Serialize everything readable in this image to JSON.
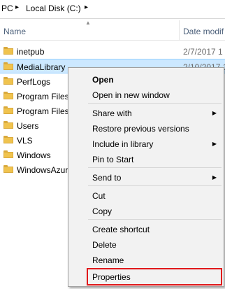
{
  "addressbar": {
    "crumbs": [
      "PC",
      "Local Disk (C:)"
    ],
    "arrow": "▸"
  },
  "columns": {
    "name": "Name",
    "date": "Date modif"
  },
  "files": [
    {
      "name": "inetpub",
      "date": "2/7/2017 1"
    },
    {
      "name": "MediaLibrary",
      "date": "2/10/2017 1"
    },
    {
      "name": "PerfLogs",
      "date": ""
    },
    {
      "name": "Program Files",
      "date": ""
    },
    {
      "name": "Program Files",
      "date": ""
    },
    {
      "name": "Users",
      "date": ""
    },
    {
      "name": "VLS",
      "date": ""
    },
    {
      "name": "Windows",
      "date": ""
    },
    {
      "name": "WindowsAzur",
      "date": ""
    }
  ],
  "context_menu": {
    "items": [
      {
        "label": "Open",
        "bold": true
      },
      {
        "label": "Open in new window"
      },
      {
        "label": "Share with",
        "submenu": true
      },
      {
        "label": "Restore previous versions"
      },
      {
        "label": "Include in library",
        "submenu": true
      },
      {
        "label": "Pin to Start"
      },
      {
        "label": "Send to",
        "submenu": true
      },
      {
        "label": "Cut"
      },
      {
        "label": "Copy"
      },
      {
        "label": "Create shortcut"
      },
      {
        "label": "Delete"
      },
      {
        "label": "Rename"
      },
      {
        "label": "Properties",
        "highlighted": true
      }
    ],
    "submenu_arrow": "▶",
    "highlight_color": "#e0191b"
  },
  "colors": {
    "selection": "#cce8ff",
    "header_text": "#4c607a",
    "folder": "#f0c34e"
  }
}
